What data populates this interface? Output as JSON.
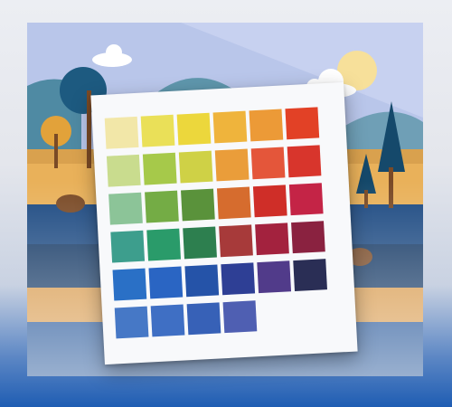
{
  "illustration": {
    "sky_color": "#b9c6ea",
    "sun_color": "#f7e09a",
    "hill_colors": [
      "#6f9fb6",
      "#4f8aa3"
    ],
    "sand_color": "#e9b15a",
    "water_colors": [
      "#1c3f73",
      "#1d4a82",
      "#163a66"
    ],
    "tree_colors": [
      "#1d5a80",
      "#e2a23a",
      "#15496b"
    ],
    "trunk_color": "#7a4a26"
  },
  "palette": {
    "rows": [
      [
        "#f2e7a8",
        "#eae058",
        "#ecd73c",
        "#efb43c",
        "#ec9a37",
        "#e24126"
      ],
      [
        "#c9dc8e",
        "#a6c94a",
        "#cfd146",
        "#ea9d3a",
        "#e4563a",
        "#d8352c"
      ],
      [
        "#8cc498",
        "#74ac45",
        "#5a923b",
        "#d66c2e",
        "#cf2e28",
        "#c42446"
      ],
      [
        "#3d9e8d",
        "#2a9b6a",
        "#2d7f4f",
        "#a73a3a",
        "#a3223e",
        "#8a2240"
      ],
      [
        "#2a70c6",
        "#2a65c3",
        "#2553a8",
        "#2e3f95",
        "#513b8a",
        "#2a2e55"
      ],
      [
        "#4678c6",
        "#3f6fc4",
        "#3761b7",
        "#4f5fb2"
      ]
    ]
  }
}
